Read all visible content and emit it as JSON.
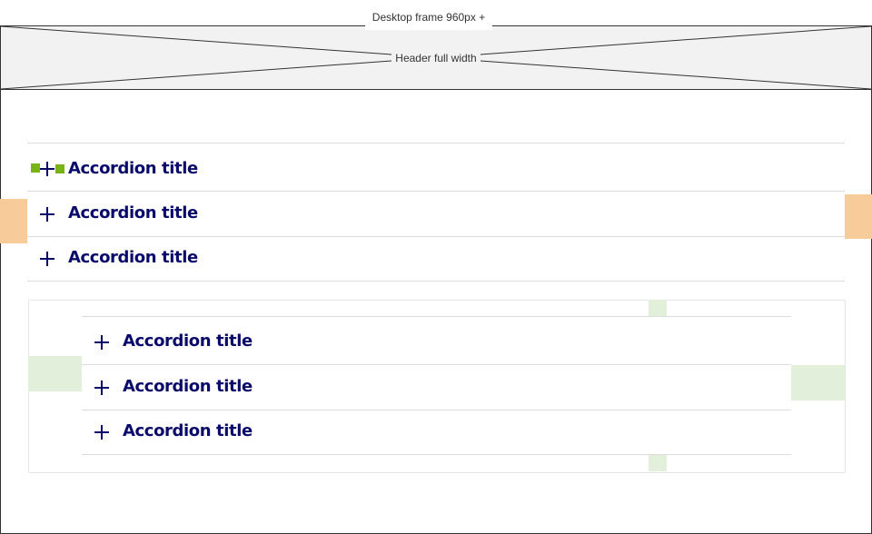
{
  "frame_label": "Desktop frame 960px +",
  "header": {
    "label": "Header full width"
  },
  "accordion_top": {
    "items": [
      {
        "title": "Accordion title"
      },
      {
        "title": "Accordion title"
      },
      {
        "title": "Accordion title"
      }
    ]
  },
  "accordion_nested": {
    "items": [
      {
        "title": "Accordion title"
      },
      {
        "title": "Accordion title"
      },
      {
        "title": "Accordion title"
      }
    ]
  },
  "colors": {
    "title": "#0a0a6b",
    "divider": "#dcdcdc",
    "orange_marker": "#f8cb9a",
    "green_marker": "#e2f0db",
    "green_square": "#7ab317",
    "header_bg": "#f2f2f2"
  },
  "icons": [
    "plus-icon"
  ]
}
